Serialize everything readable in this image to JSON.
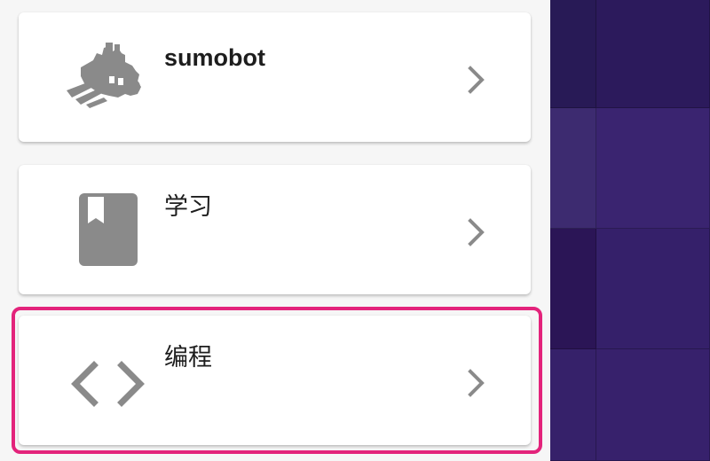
{
  "menu": {
    "items": [
      {
        "label": "sumobot",
        "icon": "robot-icon",
        "chevron": "chevron-right-icon"
      },
      {
        "label": "学习",
        "icon": "book-icon",
        "chevron": "chevron-right-icon"
      },
      {
        "label": "编程",
        "icon": "code-icon",
        "chevron": "chevron-right-icon"
      }
    ],
    "selected_index": 2
  },
  "colors": {
    "card_background": "#ffffff",
    "panel_background": "#f6f6f6",
    "icon_gray": "#8a8a8a",
    "highlight": "#e3237b",
    "right_background": "#311a62"
  }
}
